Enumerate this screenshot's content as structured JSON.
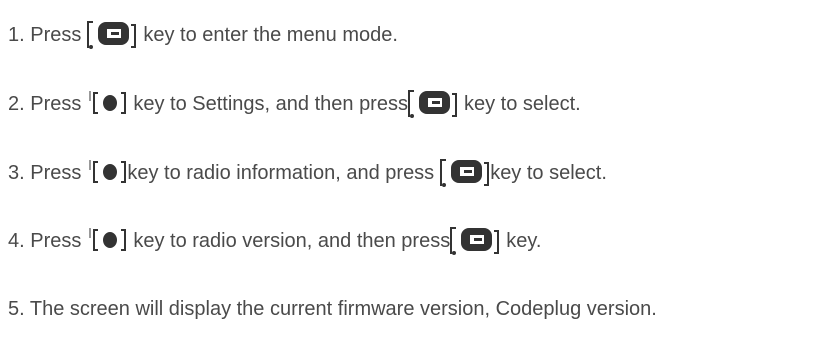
{
  "steps": [
    {
      "before": "1. Press",
      "after": "key to enter the menu mode."
    },
    {
      "before": "2. Press",
      "middle": "key to Settings, and then press",
      "after": "key to select."
    },
    {
      "before": "3. Press",
      "middle": "key to radio information, and press",
      "after": "key to select."
    },
    {
      "before": "4. Press",
      "middle": "key to radio version, and then press",
      "after": "key."
    },
    {
      "text": "5. The screen will display the current firmware version, Codeplug version."
    }
  ],
  "icons": {
    "menu_key": "menu-ok-key-icon",
    "nav_key": "navigation-key-icon"
  },
  "colors": {
    "text": "#4a4a4a",
    "icon": "#333333"
  }
}
